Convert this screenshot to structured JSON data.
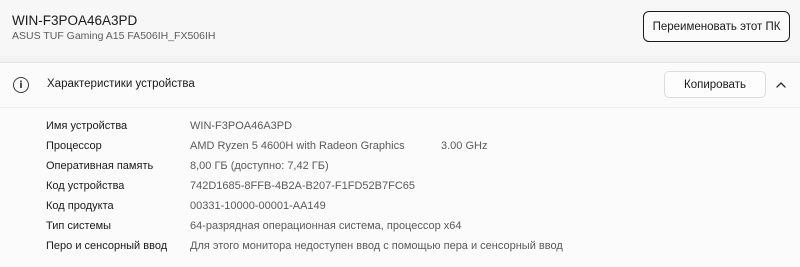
{
  "device": {
    "name": "WIN-F3POA46A3PD",
    "model": "ASUS TUF Gaming A15 FA506IH_FX506IH",
    "rename_label": "Переименовать этот ПК"
  },
  "specs": {
    "title": "Характеристики устройства",
    "copy_label": "Копировать",
    "rows": [
      {
        "label": "Имя устройства",
        "value": "WIN-F3POA46A3PD",
        "extra": ""
      },
      {
        "label": "Процессор",
        "value": "AMD Ryzen 5 4600H with Radeon Graphics",
        "extra": "3.00 GHz"
      },
      {
        "label": "Оперативная память",
        "value": "8,00 ГБ (доступно: 7,42 ГБ)",
        "extra": ""
      },
      {
        "label": "Код устройства",
        "value": "742D1685-8FFB-4B2A-B207-F1FD52B7FC65",
        "extra": ""
      },
      {
        "label": "Код продукта",
        "value": "00331-10000-00001-AA149",
        "extra": ""
      },
      {
        "label": "Тип системы",
        "value": "64-разрядная операционная система, процессор x64",
        "extra": ""
      },
      {
        "label": "Перо и сенсорный ввод",
        "value": "Для этого монитора недоступен ввод с помощью пера и сенсорный ввод",
        "extra": ""
      }
    ]
  },
  "icons": {
    "info": "info-icon",
    "collapse": "chevron-up-icon"
  }
}
